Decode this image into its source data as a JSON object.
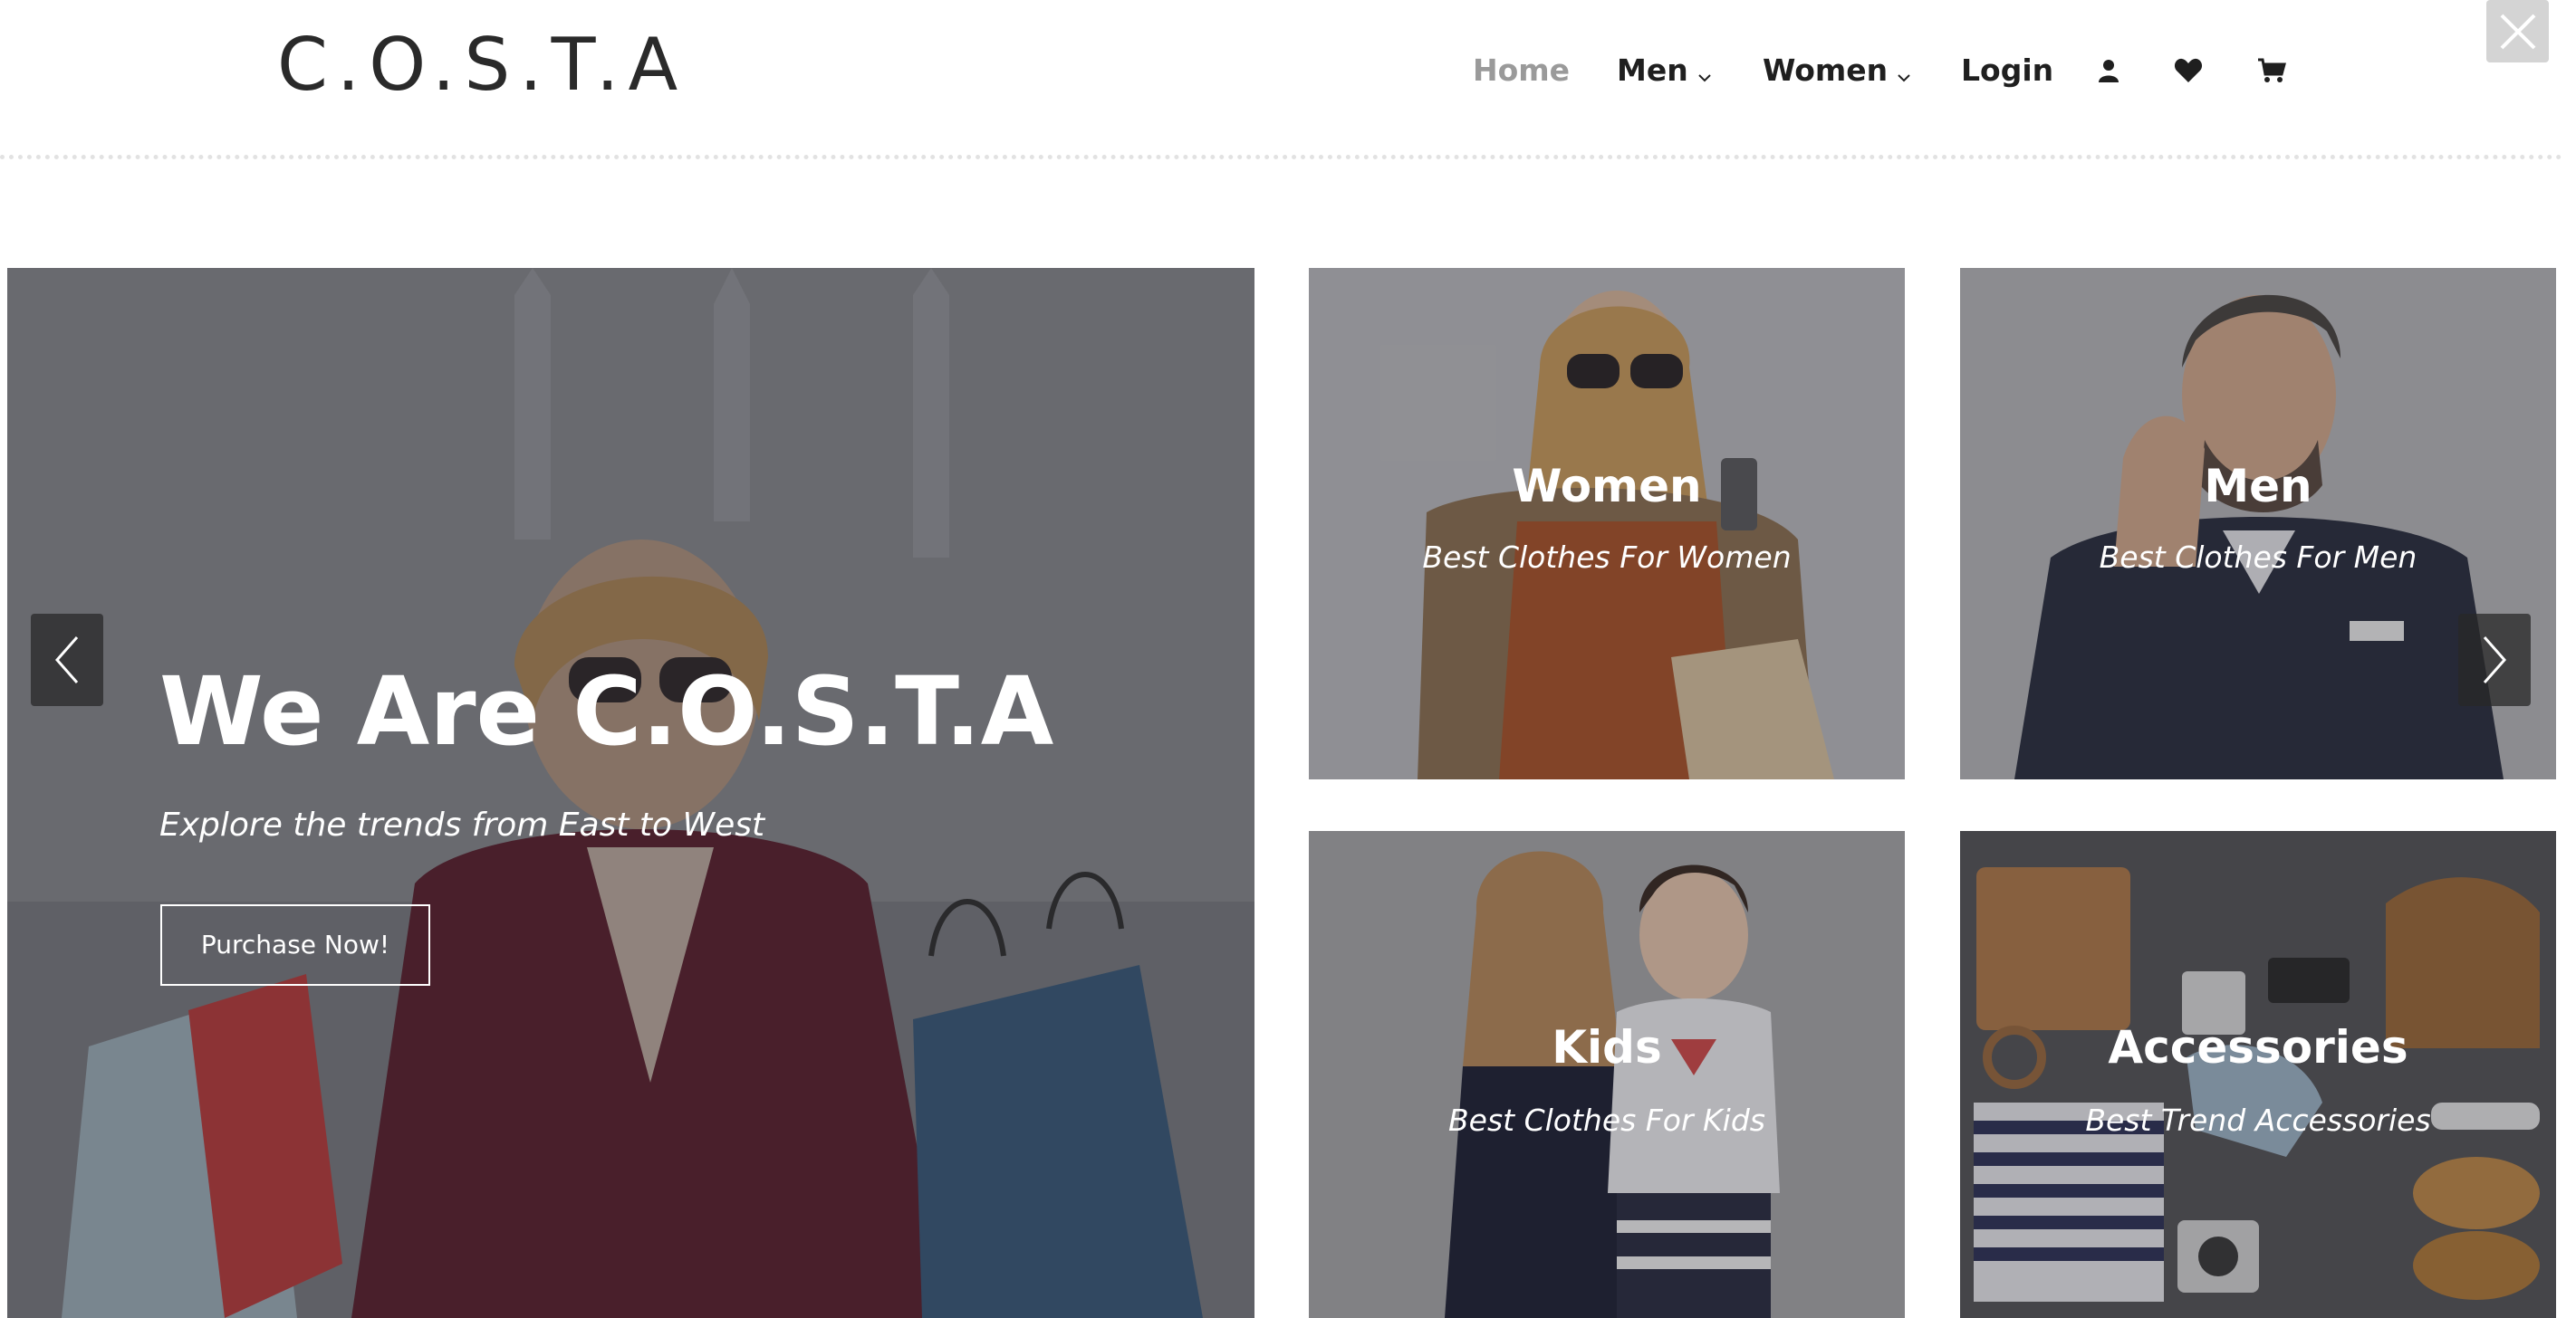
{
  "header": {
    "logo": "C.O.S.T.A",
    "nav": {
      "home": "Home",
      "men": "Men",
      "women": "Women",
      "login": "Login"
    },
    "icons": [
      "user-icon",
      "heart-icon",
      "cart-icon"
    ]
  },
  "hero": {
    "title": "We Are C.O.S.T.A",
    "subtitle": "Explore the trends from East to West",
    "button": "Purchase Now!"
  },
  "tiles": [
    {
      "title": "Women",
      "subtitle": "Best Clothes For Women"
    },
    {
      "title": "Men",
      "subtitle": "Best Clothes For Men"
    },
    {
      "title": "Kids",
      "subtitle": "Best Clothes For Kids"
    },
    {
      "title": "Accessories",
      "subtitle": "Best Trend Accessories"
    }
  ],
  "colors": {
    "nav_active": "#9a9a9a",
    "text_dark": "#1f1f1f",
    "close_bg": "#d4d4d4"
  }
}
